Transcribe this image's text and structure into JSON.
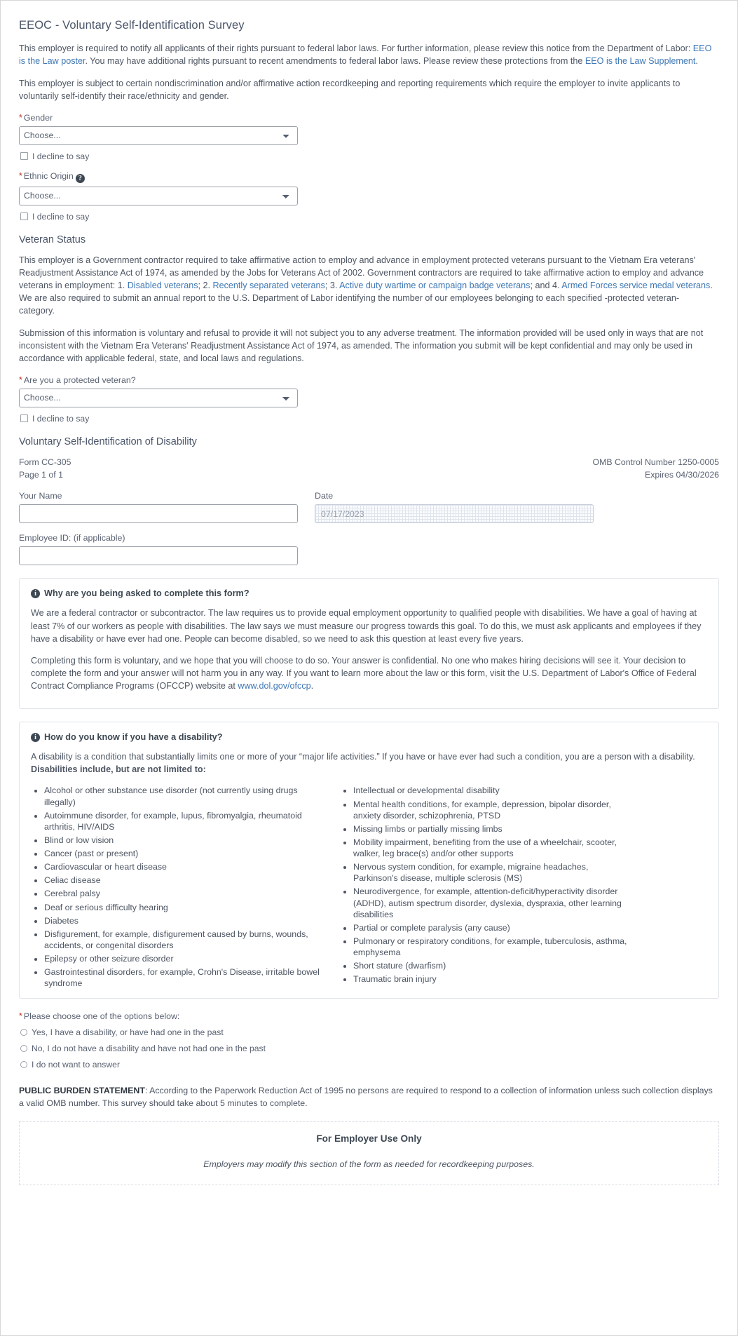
{
  "page": {
    "title": "EEOC - Voluntary Self-Identification Survey",
    "intro_p1_a": "This employer is required to notify all applicants of their rights pursuant to federal labor laws. For further information, please review this notice from the Department of Labor: ",
    "intro_link_1": "EEO is the Law poster",
    "intro_p1_b": ". You may have additional rights pursuant to recent amendments to federal labor laws. Please review these protections from the ",
    "intro_link_2": "EEO is the Law Supplement",
    "intro_p1_c": ".",
    "intro_p2": "This employer is subject to certain nondiscrimination and/or affirmative action recordkeeping and reporting requirements which require the employer to invite applicants to voluntarily self-identify their race/ethnicity and gender."
  },
  "gender": {
    "label": "Gender",
    "required_marker": "*",
    "select_value": "Choose...",
    "options": [
      "Choose..."
    ],
    "decline_label": "I decline to say"
  },
  "ethnic_origin": {
    "label": "Ethnic Origin",
    "required_marker": "*",
    "help_icon": "question-mark-icon",
    "help_glyph": "?",
    "select_value": "Choose...",
    "options": [
      "Choose..."
    ],
    "decline_label": "I decline to say"
  },
  "veteran": {
    "section_title": "Veteran Status",
    "para1_a": "This employer is a Government contractor required to take affirmative action to employ and advance in employment protected veterans pursuant to the Vietnam Era veterans' Readjustment Assistance Act of 1974, as amended by the Jobs for Veterans Act of 2002. Government contractors are required to take affirmative action to employ and advance veterans in employment: 1. ",
    "link_1": "Disabled veterans",
    "para1_b": "; 2. ",
    "link_2": "Recently separated veterans",
    "para1_c": "; 3. ",
    "link_3": "Active duty wartime or campaign badge veterans",
    "para1_d": "; and 4. ",
    "link_4": "Armed Forces service medal veterans",
    "para1_e": ". We are also required to submit an annual report to the U.S. Department of Labor identifying the number of our employees belonging to each specified -protected veteran- category.",
    "para2": "Submission of this information is voluntary and refusal to provide it will not subject you to any adverse treatment. The information provided will be used only in ways that are not inconsistent with the Vietnam Era Veterans' Readjustment Assistance Act of 1974, as amended. The information you submit will be kept confidential and may only be used in accordance with applicable federal, state, and local laws and regulations.",
    "question_label": "Are you a protected veteran?",
    "required_marker": "*",
    "select_value": "Choose...",
    "options": [
      "Choose..."
    ],
    "decline_label": "I decline to say"
  },
  "disability": {
    "section_title": "Voluntary Self-Identification of Disability",
    "form_number": "Form CC-305",
    "page_of": "Page 1 of 1",
    "omb_control": "OMB Control Number 1250-0005",
    "expires": "Expires 04/30/2026",
    "name_label": "Your Name",
    "name_value": "",
    "name_placeholder": "",
    "date_label": "Date",
    "date_value": "07/17/2023",
    "employee_id_label": "Employee ID: (if applicable)",
    "employee_id_value": "",
    "why_panel": {
      "icon": "info-icon",
      "icon_glyph": "i",
      "heading": "Why are you being asked to complete this form?",
      "para1": "We are a federal contractor or subcontractor. The law requires us to provide equal employment opportunity to qualified people with disabilities. We have a goal of having at least 7% of our workers as people with disabilities. The law says we must measure our progress towards this goal. To do this, we must ask applicants and employees if they have a disability or have ever had one. People can become disabled, so we need to ask this question at least every five years.",
      "para2_a": "Completing this form is voluntary, and we hope that you will choose to do so. Your answer is confidential. No one who makes hiring decisions will see it. Your decision to complete the form and your answer will not harm you in any way. If you want to learn more about the law or this form, visit the U.S. Department of Labor's Office of Federal Contract Compliance Programs (OFCCP) website at ",
      "para2_link": "www.dol.gov/ofccp",
      "para2_b": "."
    },
    "how_panel": {
      "icon": "info-icon",
      "icon_glyph": "i",
      "heading": "How do you know if you have a disability?",
      "intro_a": "A disability is a condition that substantially limits one or more of your “major life activities.” If you have or have ever had such a condition, you are a person with a disability. ",
      "intro_bold": "Disabilities include, but are not limited to:",
      "list_left": [
        "Alcohol or other substance use disorder (not currently using drugs illegally)",
        "Autoimmune disorder, for example, lupus, fibromyalgia, rheumatoid arthritis, HIV/AIDS",
        "Blind or low vision",
        "Cancer (past or present)",
        "Cardiovascular or heart disease",
        "Celiac disease",
        "Cerebral palsy",
        "Deaf or serious difficulty hearing",
        "Diabetes",
        "Disfigurement, for example, disfigurement caused by burns, wounds, accidents, or congenital disorders",
        "Epilepsy or other seizure disorder",
        "Gastrointestinal disorders, for example, Crohn's Disease, irritable bowel syndrome"
      ],
      "list_right": [
        "Intellectual or developmental disability",
        "Mental health conditions, for example, depression, bipolar disorder, anxiety disorder, schizophrenia, PTSD",
        "Missing limbs or partially missing limbs",
        "Mobility impairment, benefiting from the use of a wheelchair, scooter, walker, leg brace(s) and/or other supports",
        "Nervous system condition, for example, migraine headaches, Parkinson's disease, multiple sclerosis (MS)",
        "Neurodivergence, for example, attention-deficit/hyperactivity disorder (ADHD), autism spectrum disorder, dyslexia, dyspraxia, other learning disabilities",
        "Partial or complete paralysis (any cause)",
        "Pulmonary or respiratory conditions, for example, tuberculosis, asthma, emphysema",
        "Short stature (dwarfism)",
        "Traumatic brain injury"
      ]
    },
    "choice_label": "Please choose one of the options below:",
    "choice_required_marker": "*",
    "choices": [
      "Yes, I have a disability, or have had one in the past",
      "No, I do not have a disability and have not had one in the past",
      "I do not want to answer"
    ],
    "burden_bold": "PUBLIC BURDEN STATEMENT",
    "burden_text": ": According to the Paperwork Reduction Act of 1995 no persons are required to respond to a collection of information unless such collection displays a valid OMB number. This survey should take about 5 minutes to complete.",
    "employer_box": {
      "title": "For Employer Use Only",
      "note": "Employers may modify this section of the form as needed for recordkeeping purposes."
    }
  },
  "colors": {
    "link": "#3e77b5",
    "required": "#c0392b",
    "text": "#4d5562",
    "heading": "#4a5568",
    "border": "#d7d7d7"
  }
}
